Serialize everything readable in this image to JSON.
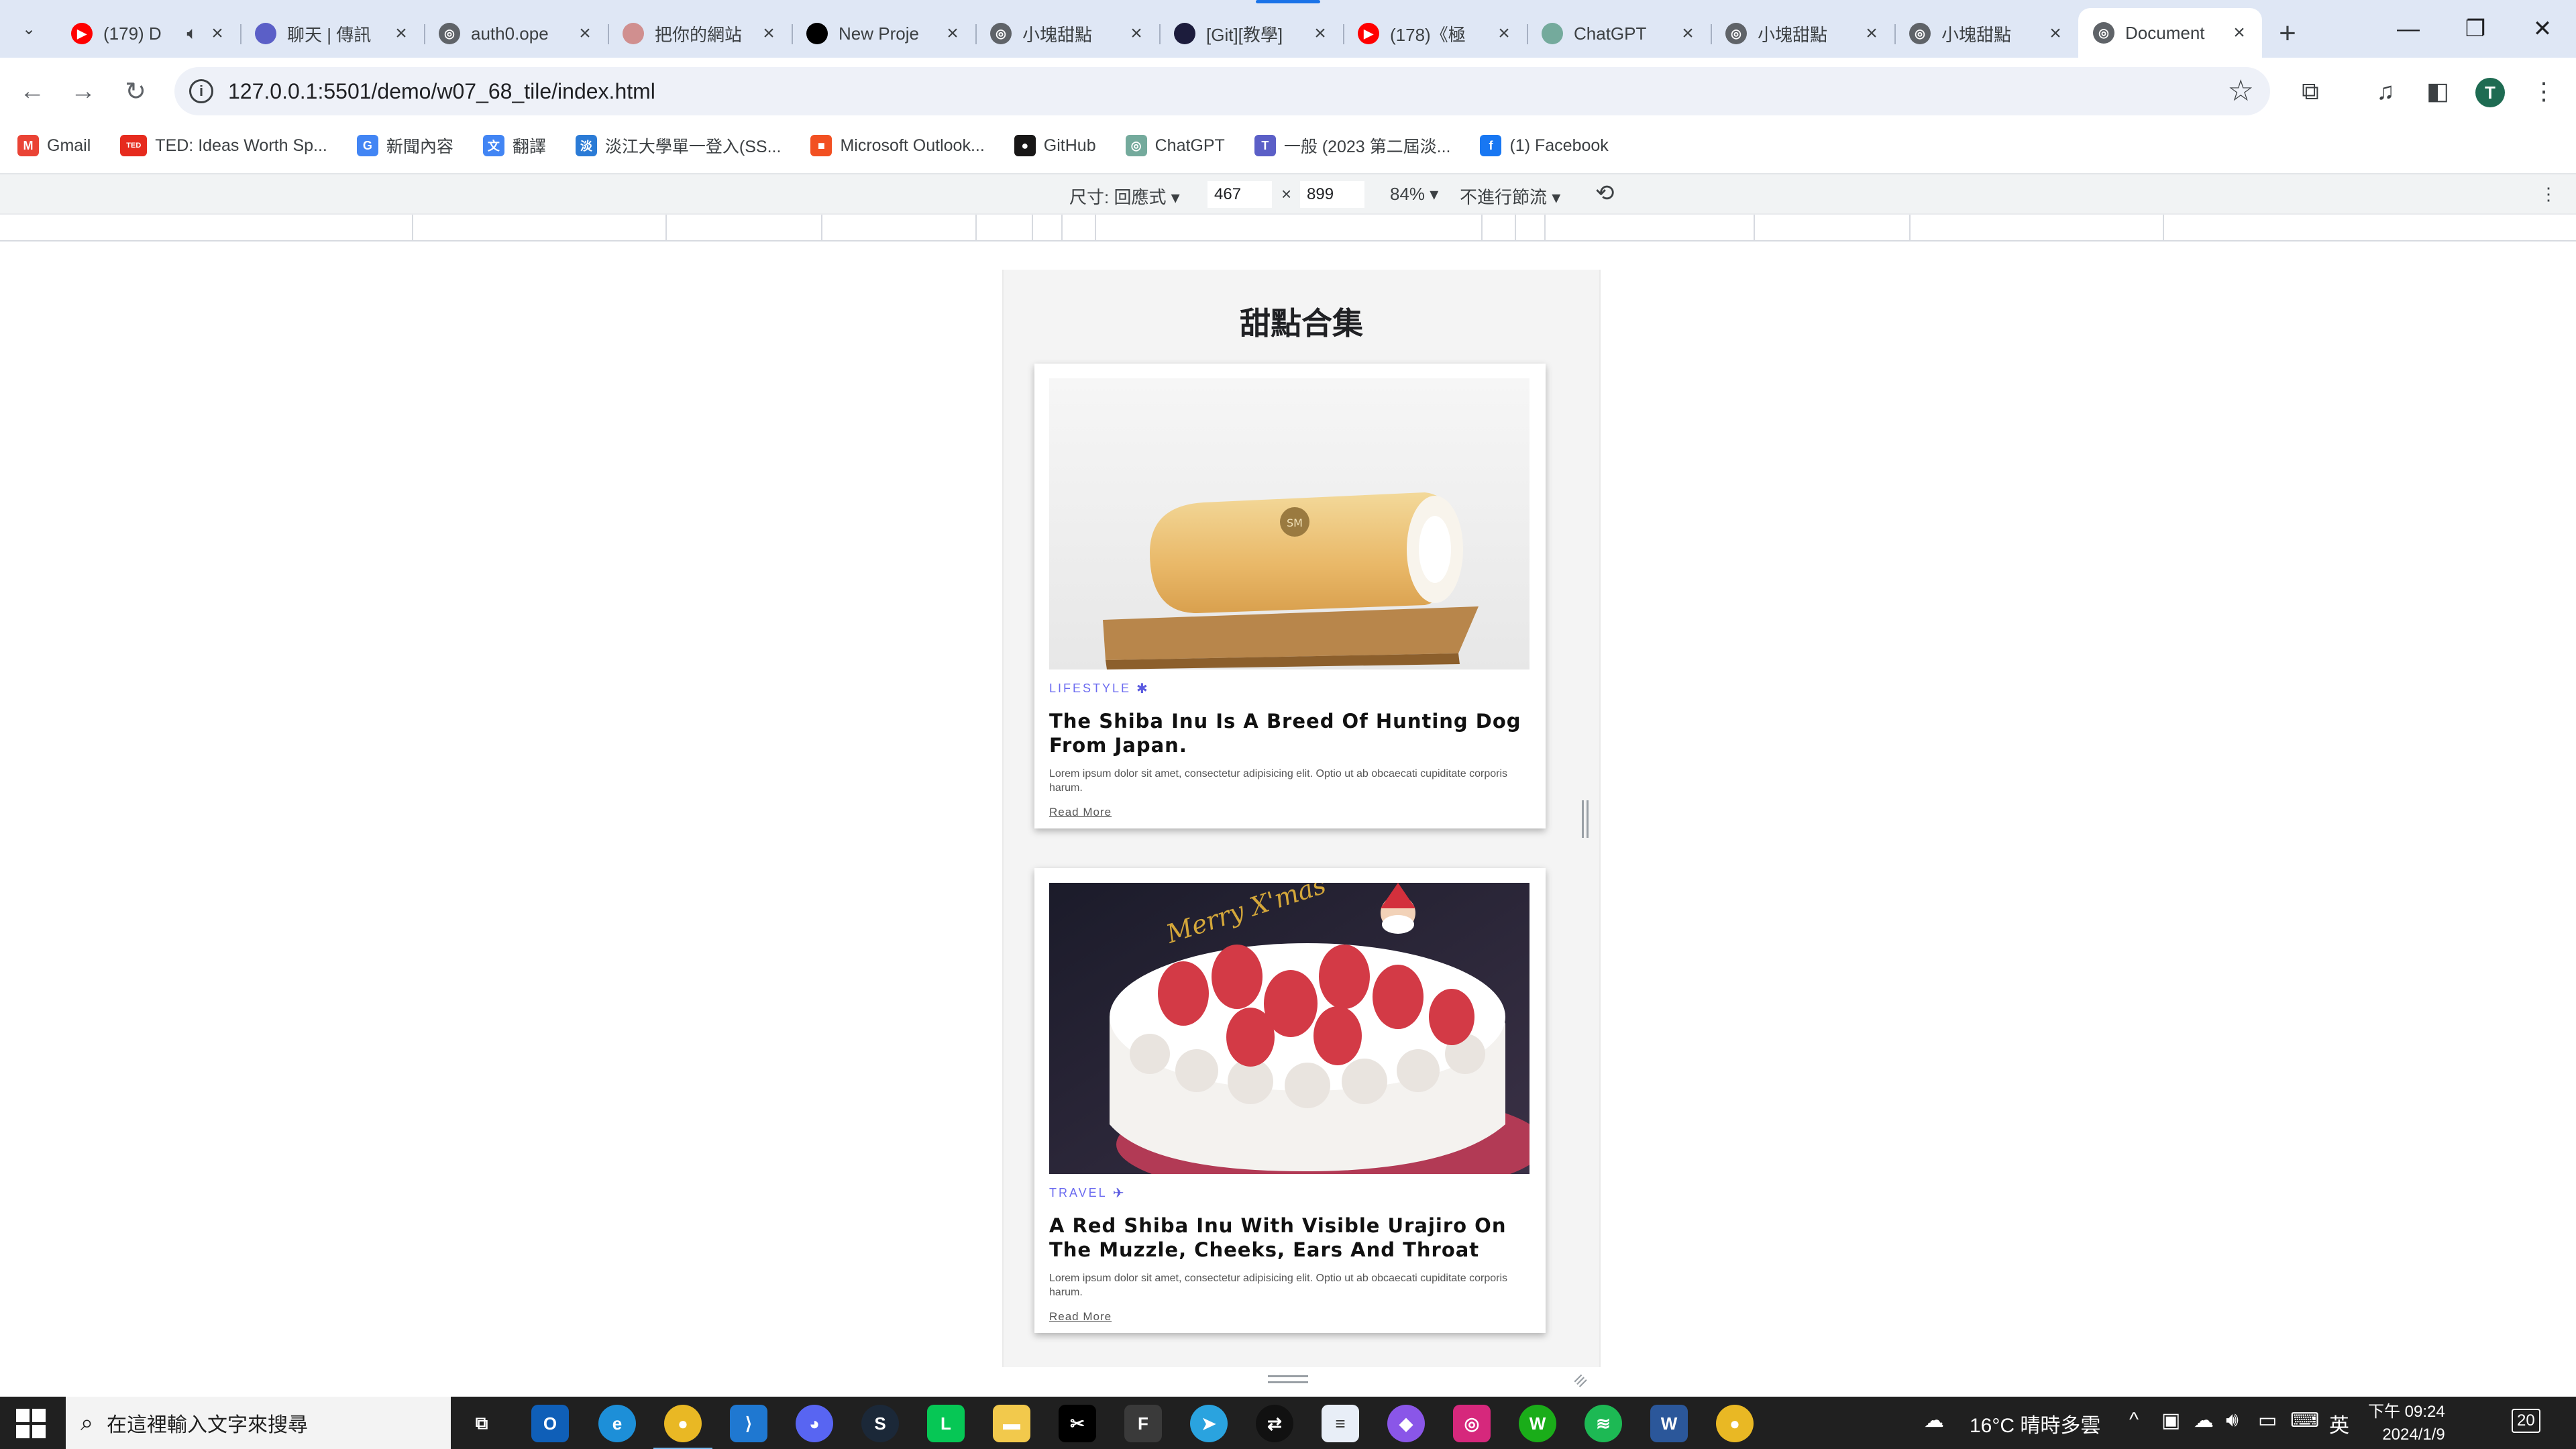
{
  "browser": {
    "tabs": [
      {
        "title": "(179) D",
        "icon": "youtube-icon",
        "color": "#ff0000",
        "speaker": true
      },
      {
        "title": "聊天 | 傳訊",
        "icon": "teams-icon",
        "color": "#5b5fc7"
      },
      {
        "title": "auth0.ope",
        "icon": "globe-icon",
        "color": "#5f6368"
      },
      {
        "title": "把你的網站",
        "icon": "gradient-icon",
        "color": "#d08f8f"
      },
      {
        "title": "New Proje",
        "icon": "vercel-icon",
        "color": "#000000"
      },
      {
        "title": "小塊甜點",
        "icon": "globe-icon",
        "color": "#5f6368"
      },
      {
        "title": "[Git][教學]",
        "icon": "site-icon",
        "color": "#1c1c3c"
      },
      {
        "title": "(178)《極",
        "icon": "youtube-icon",
        "color": "#ff0000"
      },
      {
        "title": "ChatGPT",
        "icon": "chatgpt-icon",
        "color": "#74aa9c"
      },
      {
        "title": "小塊甜點",
        "icon": "globe-icon",
        "color": "#5f6368"
      },
      {
        "title": "小塊甜點",
        "icon": "globe-icon",
        "color": "#5f6368"
      },
      {
        "title": "Document",
        "icon": "globe-icon",
        "color": "#5f6368",
        "active": true
      }
    ],
    "url": "127.0.0.1:5501/demo/w07_68_tile/index.html",
    "profile_initial": "T",
    "bookmarks": [
      {
        "label": "Gmail",
        "icon": "gmail-icon",
        "glyph": "M",
        "color": "#ea4335"
      },
      {
        "label": "TED: Ideas Worth Sp...",
        "icon": "ted-icon",
        "glyph": "TED",
        "color": "#e62b1e"
      },
      {
        "label": "新聞內容",
        "icon": "news-icon",
        "glyph": "G",
        "color": "#4285f4"
      },
      {
        "label": "翻譯",
        "icon": "translate-icon",
        "glyph": "文",
        "color": "#4285f4"
      },
      {
        "label": "淡江大學單一登入(SS...",
        "icon": "tku-icon",
        "glyph": "淡",
        "color": "#2b7bd6"
      },
      {
        "label": "Microsoft Outlook...",
        "icon": "microsoft-icon",
        "glyph": "■",
        "color": "#f25022"
      },
      {
        "label": "GitHub",
        "icon": "github-icon",
        "glyph": "●",
        "color": "#181717"
      },
      {
        "label": "ChatGPT",
        "icon": "chatgpt-icon",
        "glyph": "◎",
        "color": "#74aa9c"
      },
      {
        "label": "一般 (2023 第二屆淡...",
        "icon": "teams-icon",
        "glyph": "T",
        "color": "#5b5fc7"
      },
      {
        "label": "(1) Facebook",
        "icon": "facebook-icon",
        "glyph": "f",
        "color": "#1877f2"
      }
    ]
  },
  "devtools": {
    "dimensions_label": "尺寸: 回應式",
    "width": "467",
    "times": "×",
    "height": "899",
    "zoom": "84%",
    "throttle": "不進行節流"
  },
  "page": {
    "title": "甜點合集",
    "cards": [
      {
        "category": "LIFESTYLE",
        "category_icon": "asterisk-icon",
        "title": "The Shiba Inu Is A Breed Of Hunting Dog From Japan.",
        "text": "Lorem ipsum dolor sit amet, consectetur adipisicing elit. Optio ut ab obcaecati cupiditate corporis harum.",
        "link": "Read More",
        "image": "roll-cake-image"
      },
      {
        "category": "TRAVEL",
        "category_icon": "plane-icon",
        "title": "A Red Shiba Inu With Visible Urajiro On The Muzzle, Cheeks, Ears And Throat",
        "text": "Lorem ipsum dolor sit amet, consectetur adipisicing elit. Optio ut ab obcaecati cupiditate corporis harum.",
        "link": "Read More",
        "image": "strawberry-cake-image"
      }
    ]
  },
  "taskbar": {
    "search_placeholder": "在這裡輸入文字來搜尋",
    "weather": "16°C 晴時多雲",
    "ime": "英",
    "time": "下午 09:24",
    "date": "2024/1/9",
    "notification_count": "20"
  }
}
